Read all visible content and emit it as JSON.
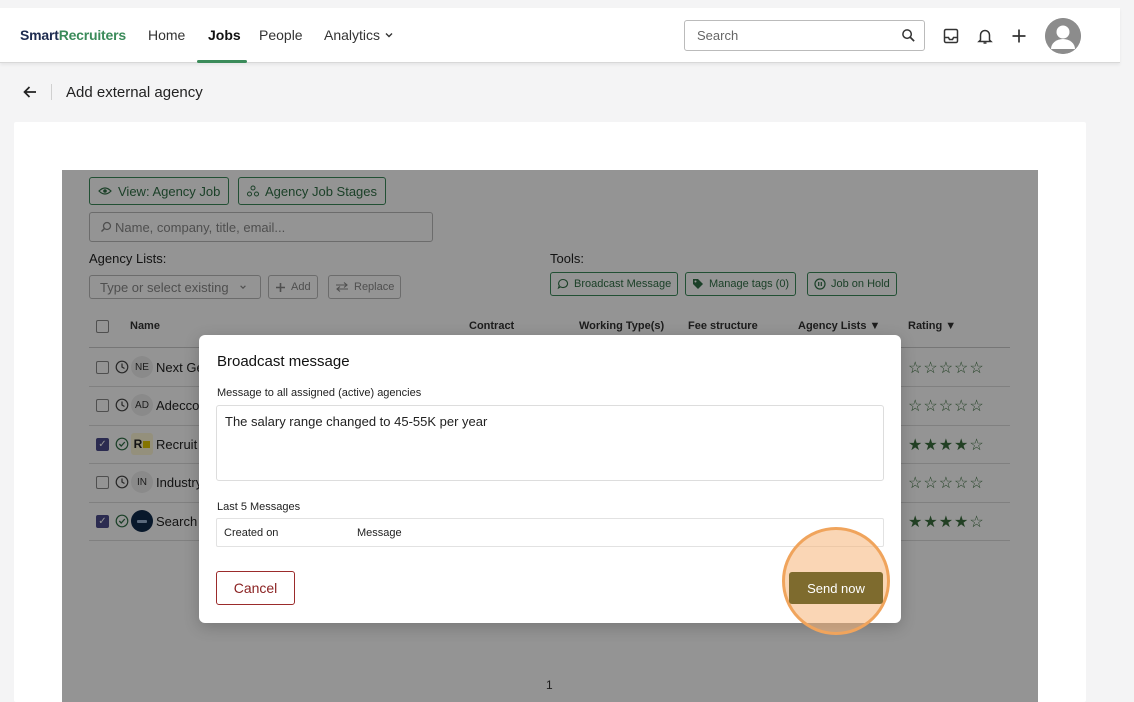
{
  "brand": {
    "part1": "Smart",
    "part2": "Recruiters"
  },
  "nav": {
    "home": "Home",
    "jobs": "Jobs",
    "people": "People",
    "analytics": "Analytics"
  },
  "search": {
    "placeholder": "Search"
  },
  "page": {
    "title": "Add external agency"
  },
  "toolbar": {
    "view_agency_job": "View: Agency Job",
    "agency_job_stages": "Agency Job Stages",
    "name_search_placeholder": "Name, company, title, email...",
    "agency_lists_label": "Agency Lists:",
    "list_select_placeholder": "Type or select existing",
    "add": "Add",
    "replace": "Replace",
    "tools_label": "Tools:",
    "broadcast": "Broadcast Message",
    "manage_tags": "Manage tags (0)",
    "job_on_hold": "Job on Hold"
  },
  "table": {
    "columns": [
      "Name",
      "Contract",
      "Working Type(s)",
      "Fee structure",
      "Agency Lists",
      "Rating"
    ],
    "rows": [
      {
        "badge": "NE",
        "name": "Next Ge",
        "checked": false,
        "stars": "☆☆☆☆☆"
      },
      {
        "badge": "AD",
        "name": "Adecco",
        "checked": false,
        "stars": "☆☆☆☆☆"
      },
      {
        "badge": "",
        "name": "Recruit",
        "checked": true,
        "stars": "★★★★☆"
      },
      {
        "badge": "IN",
        "name": "Industry",
        "checked": false,
        "stars": "☆☆☆☆☆"
      },
      {
        "badge": "",
        "name": "Search",
        "checked": true,
        "stars": "★★★★☆"
      }
    ]
  },
  "pager": {
    "page": "1"
  },
  "modal": {
    "title": "Broadcast message",
    "label": "Message to all assigned (active) agencies",
    "message": "The salary range changed to 45-55K per year",
    "last_label": "Last 5 Messages",
    "col_created": "Created on",
    "col_message": "Message",
    "cancel": "Cancel",
    "send": "Send now"
  },
  "colors": {
    "brand_green": "#3b8b5a",
    "send_button": "#7e6b2e",
    "highlight": "#f0a45c",
    "cancel": "#8b2323"
  }
}
